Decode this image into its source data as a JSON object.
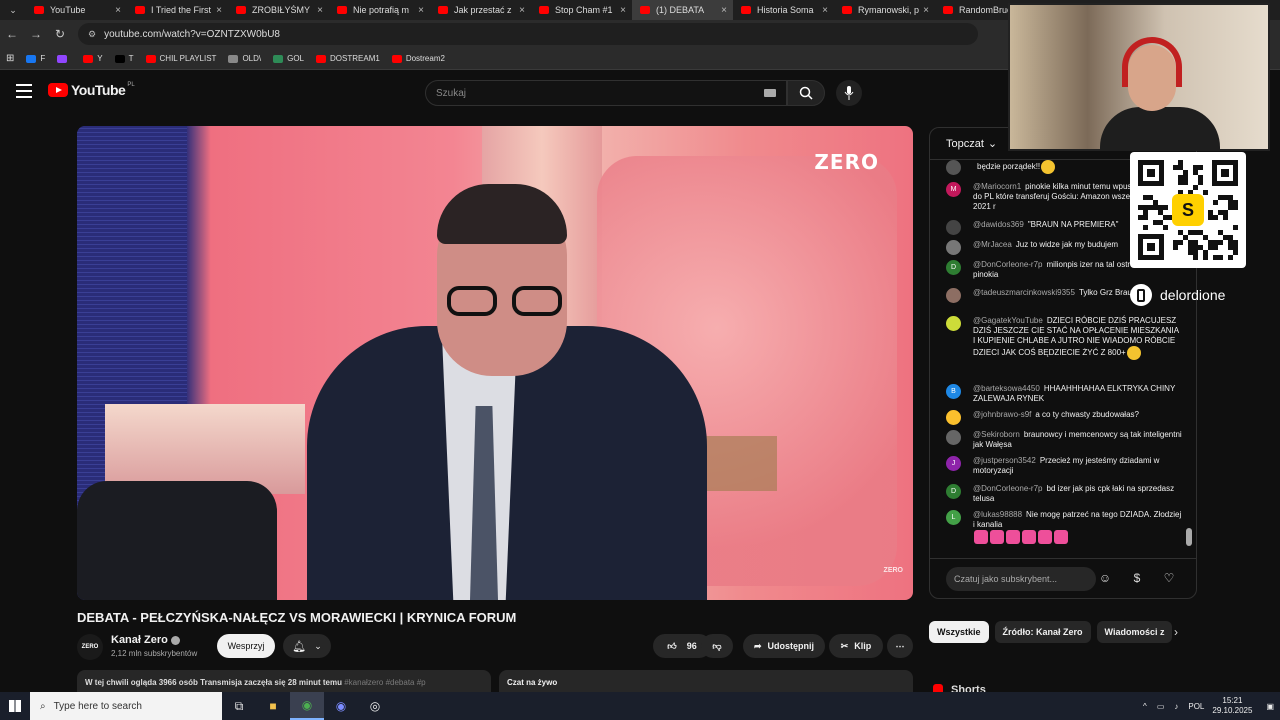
{
  "browser": {
    "tabs": [
      {
        "label": "YouTube",
        "active": false
      },
      {
        "label": "I Tried the First",
        "active": false
      },
      {
        "label": "ZROBIŁYŚMY",
        "active": false
      },
      {
        "label": "Nie potrafią m",
        "active": false
      },
      {
        "label": "Jak przestać z",
        "active": false
      },
      {
        "label": "Stop Cham #1",
        "active": false
      },
      {
        "label": "(1) DEBATA",
        "active": true
      },
      {
        "label": "Historia Soma",
        "active": false
      },
      {
        "label": "Rymanowski, p",
        "active": false
      },
      {
        "label": "RandomBruce",
        "active": false
      }
    ],
    "url": "youtube.com/watch?v=OZNTZXW0bU8",
    "bookmarks": [
      {
        "label": "F",
        "color": "#1877f2"
      },
      {
        "label": "",
        "color": "#9146ff"
      },
      {
        "label": "Y",
        "color": "#ff0000"
      },
      {
        "label": "T",
        "color": "#000000"
      },
      {
        "label": "CHIL PLAYLIST",
        "color": "#ff0000"
      },
      {
        "label": "OLD\\",
        "color": "#888888"
      },
      {
        "label": "GOL",
        "color": "#2e8b57"
      },
      {
        "label": "DOSTREAM1",
        "color": "#ff0000"
      },
      {
        "label": "Dostream2",
        "color": "#ff0000"
      }
    ]
  },
  "header": {
    "logo_text": "YouTube",
    "country": "PL",
    "search_placeholder": "Szukaj"
  },
  "video": {
    "brand": "ZERO",
    "brand_small": "ZERO",
    "title": "DEBATA - PEŁCZYŃSKA-NAŁĘCZ VS MORAWIECKI | KRYNICA FORUM",
    "channel": "Kanał Zero",
    "channel_avatar": "ZERO",
    "subscribers": "2,12 mln subskrybentów",
    "support_label": "Wesprzyj",
    "likes": "96",
    "share_label": "Udostępnij",
    "clip_label": "Klip",
    "description": "W tej chwili ogląda 3966 osób  Transmisja zaczęła się 28 minut temu",
    "description_tags": "#kanałzero #debata #p",
    "live_chat_label": "Czat na żywo"
  },
  "chat": {
    "mode": "Topczat",
    "messages": [
      {
        "author": "",
        "text": "będzie porządek!!",
        "avatar": "",
        "avatar_color": "#555555",
        "emoji": true
      },
      {
        "author": "@Mariocorn1",
        "text": "pinokie kilka minut temu wpuszczaniu firm do PL które transferuj Gościu: Amazon wszedł do PL w 2021 r",
        "avatar": "M",
        "avatar_color": "#c2185b"
      },
      {
        "author": "@dawidos369",
        "text": "\"BRAUN NA PREMIERA\"",
        "avatar": "",
        "avatar_color": "#444444"
      },
      {
        "author": "@MrJacea",
        "text": "Juz to widze jak my budujem",
        "avatar": "",
        "avatar_color": "#777777"
      },
      {
        "author": "@DonCorleone-r7p",
        "text": "milionpis izer na tal ostroleki od pinokia",
        "avatar": "D",
        "avatar_color": "#2e7d32"
      },
      {
        "author": "@tadeuszmarcinkowski9355",
        "text": "Tylko Grz Braun.",
        "avatar": "",
        "avatar_color": "#8d6e63"
      },
      {
        "author": "@GagatekYouTube",
        "text": "DZIECI RÓBCIE DZIŚ PRACUJESZ DZIŚ JESZCZE CIE STAĆ NA OPŁACENIE MIESZKANIA I KUPIENIE CHLABE A JUTRO NIE WIADOMO RÓBCIE DZIECI JAK COŚ BĘDZIECIE ŻYĆ Z 800+",
        "avatar": "",
        "avatar_color": "#cddc39",
        "emoji": true
      },
      {
        "author": "@barteksowa4450",
        "text": "HHAAHHHAHAA ELKTRYKA CHINY ZALEWAJA RYNEK",
        "avatar": "B",
        "avatar_color": "#1e88e5"
      },
      {
        "author": "@johnbrawo-s9f",
        "text": "a co ty chwasty zbudowałas?",
        "avatar": "",
        "avatar_color": "#fbc02d"
      },
      {
        "author": "@Sekiroborn",
        "text": "braunowcy i memcenowcy są tak inteligentni jak Wałęsa",
        "avatar": "",
        "avatar_color": "#666666"
      },
      {
        "author": "@justperson3542",
        "text": "Przecież my jesteśmy dziadami w motoryzacji",
        "avatar": "J",
        "avatar_color": "#8e24aa"
      },
      {
        "author": "@DonCorleone-r7p",
        "text": "bd izer jak pis cpk łaki na sprzedasz telusa",
        "avatar": "D",
        "avatar_color": "#2e7d32"
      },
      {
        "author": "@lukas98888",
        "text": "Nie mogę patrzeć na tego DZIADA. Złodziej i kanalia",
        "avatar": "L",
        "avatar_color": "#43a047",
        "pink_emojis": true
      }
    ],
    "input_placeholder": "Czatuj jako subskrybent..."
  },
  "chips": [
    "Wszystkie",
    "Źródło: Kanał Zero",
    "Wiadomości z"
  ],
  "shorts_label": "Shorts",
  "overlay": {
    "qr_badge": "S",
    "handle": "delordione"
  },
  "taskbar": {
    "search_placeholder": "Type here to search",
    "lang": "POL",
    "time": "15:21",
    "date": "29.10.2025"
  }
}
